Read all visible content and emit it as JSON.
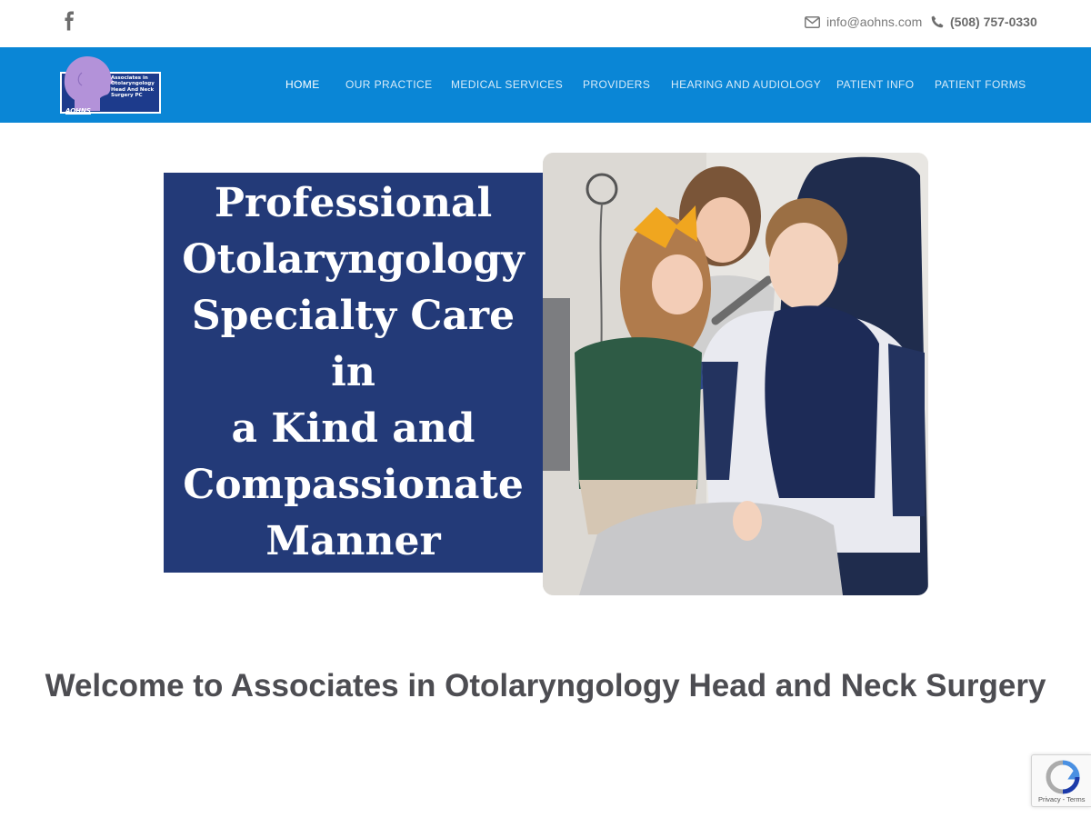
{
  "topbar": {
    "email": "info@aohns.com",
    "phone": "(508) 757-0330"
  },
  "logo": {
    "text": "Associates in Otolaryngology Head And Neck Surgery PC",
    "abbr": "AOHNS"
  },
  "nav": {
    "items": [
      {
        "label": "HOME"
      },
      {
        "label": "OUR PRACTICE"
      },
      {
        "label": "MEDICAL SERVICES"
      },
      {
        "label": "PROVIDERS"
      },
      {
        "label": "HEARING AND AUDIOLOGY"
      },
      {
        "label": "PATIENT INFO"
      },
      {
        "label": "PATIENT FORMS"
      }
    ]
  },
  "hero": {
    "line1": "Professional",
    "line2": "Otolaryngology",
    "line3": "Specialty Care in",
    "line4": "a Kind and",
    "line5": "Compassionate",
    "line6": "Manner"
  },
  "welcome": {
    "heading": "Welcome to Associates in Otolaryngology Head and Neck Surgery"
  },
  "recaptcha": {
    "links": "Privacy - Terms"
  },
  "colors": {
    "nav_bg": "#0a86d6",
    "hero_panel": "#233a78",
    "logo_head": "#b392d9"
  }
}
